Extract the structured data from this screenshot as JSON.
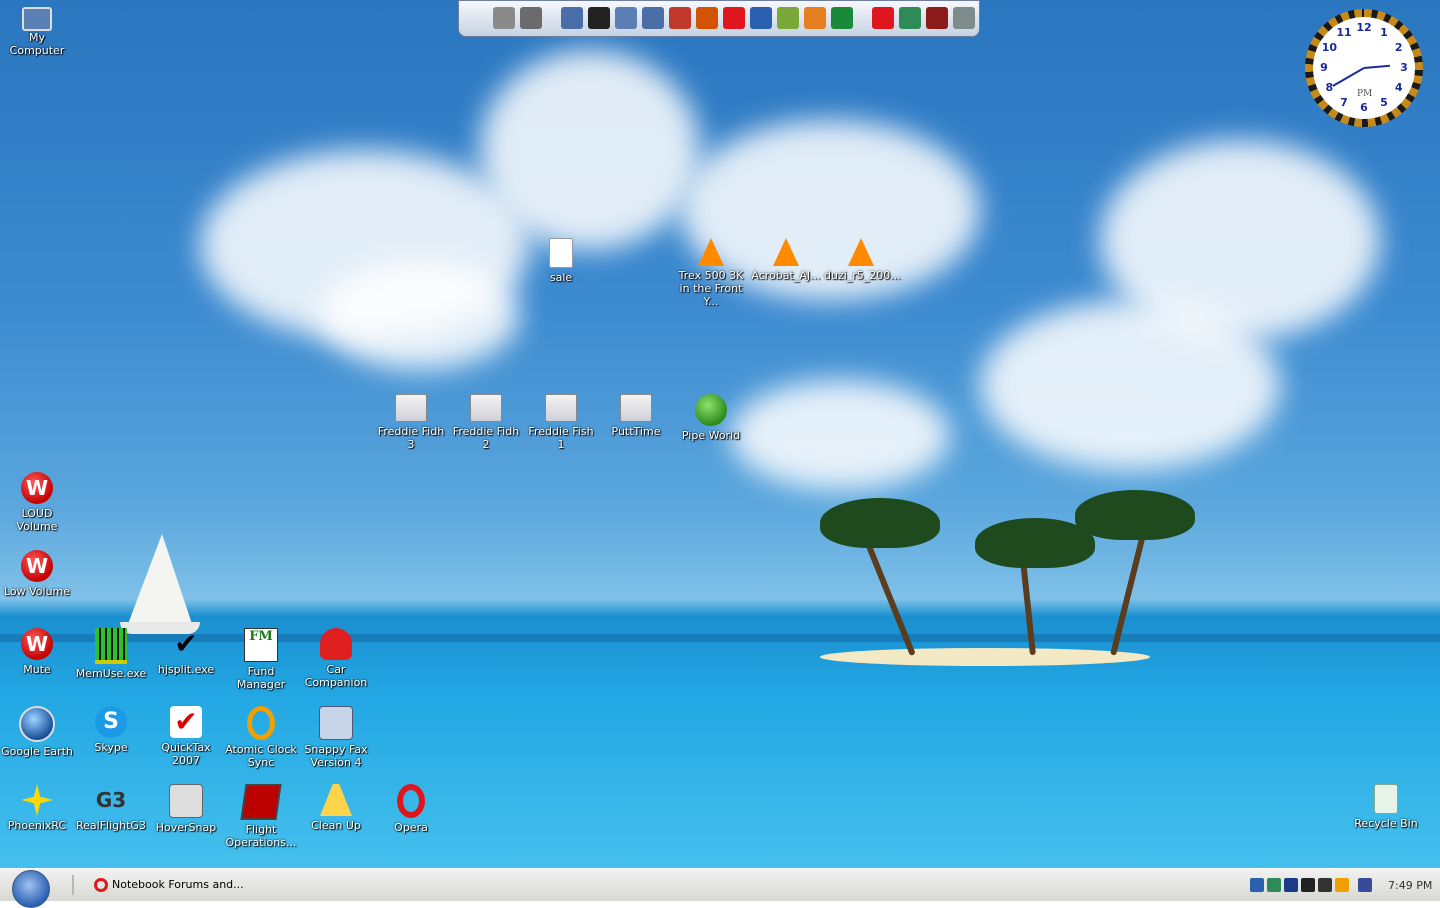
{
  "desktop": {
    "icons": [
      {
        "id": "my-computer",
        "label": "My Computer",
        "glyph": "monitor"
      },
      {
        "id": "sale",
        "label": "sale",
        "glyph": "file"
      },
      {
        "id": "trex",
        "label": "Trex 500 3K in the Front Y...",
        "glyph": "vlc"
      },
      {
        "id": "acrobat",
        "label": "Acrobat_AJ...",
        "glyph": "vlc"
      },
      {
        "id": "duzi",
        "label": "duzi_r5_200...",
        "glyph": "vlc"
      },
      {
        "id": "freddie3",
        "label": "Freddie Fidh 3",
        "glyph": "generic"
      },
      {
        "id": "freddie2",
        "label": "Freddie Fidh 2",
        "glyph": "generic"
      },
      {
        "id": "freddie1",
        "label": "Freddie Fish 1",
        "glyph": "generic"
      },
      {
        "id": "putttime",
        "label": "PuttTime",
        "glyph": "generic"
      },
      {
        "id": "pipeworld",
        "label": "Pipe World",
        "glyph": "pipe"
      },
      {
        "id": "loud-volume",
        "label": "LOUD Volume",
        "glyph": "wpaw",
        "text": "W"
      },
      {
        "id": "low-volume",
        "label": "Low Volume",
        "glyph": "wpaw",
        "text": "W"
      },
      {
        "id": "mute",
        "label": "Mute",
        "glyph": "wpaw",
        "text": "W"
      },
      {
        "id": "memuse",
        "label": "MemUse.exe",
        "glyph": "bars"
      },
      {
        "id": "hjsplit",
        "label": "hjsplit.exe",
        "glyph": "check",
        "text": "✔"
      },
      {
        "id": "fund-manager",
        "label": "Fund Manager",
        "glyph": "fm",
        "text": "FM"
      },
      {
        "id": "car-companion",
        "label": "Car Companion",
        "glyph": "car"
      },
      {
        "id": "google-earth",
        "label": "Google Earth",
        "glyph": "earth"
      },
      {
        "id": "skype",
        "label": "Skype",
        "glyph": "skype",
        "text": "S"
      },
      {
        "id": "quicktax",
        "label": "QuickTax 2007",
        "glyph": "quicktax",
        "text": "✔"
      },
      {
        "id": "atomic-clock",
        "label": "Atomic Clock Sync",
        "glyph": "atomic"
      },
      {
        "id": "snappy-fax",
        "label": "Snappy Fax Version 4",
        "glyph": "fax"
      },
      {
        "id": "phoenixrc",
        "label": "PhoenixRC",
        "glyph": "phoenix"
      },
      {
        "id": "realflight",
        "label": "RealFlightG3",
        "glyph": "g3",
        "text": "G3"
      },
      {
        "id": "hoversnap",
        "label": "HoverSnap",
        "glyph": "camera"
      },
      {
        "id": "flight-ops",
        "label": "Flight Operations...",
        "glyph": "flight"
      },
      {
        "id": "cleanup",
        "label": "Clean Up",
        "glyph": "broom"
      },
      {
        "id": "opera",
        "label": "Opera",
        "glyph": "opera"
      },
      {
        "id": "recycle-bin",
        "label": "Recycle Bin",
        "glyph": "recycle"
      }
    ]
  },
  "quickbar": {
    "icons": [
      {
        "name": "network-icon",
        "color": "#8a8a8a"
      },
      {
        "name": "tools-icon",
        "color": "#6b6b6b"
      },
      {
        "name": "monitor-icon",
        "color": "#4a6ea8"
      },
      {
        "name": "linux-penguin-icon",
        "color": "#222222"
      },
      {
        "name": "document-icon",
        "color": "#5a7fb5"
      },
      {
        "name": "screenshot-icon",
        "color": "#4a6ea8"
      },
      {
        "name": "toolbox-icon",
        "color": "#c0392b"
      },
      {
        "name": "search-icon",
        "color": "#d35400"
      },
      {
        "name": "quicktime-icon",
        "color": "#e0161e"
      },
      {
        "name": "m-logo-icon",
        "color": "#2b5fb0"
      },
      {
        "name": "pen-icon",
        "color": "#7aa83a"
      },
      {
        "name": "picasa-icon",
        "color": "#e67e22"
      },
      {
        "name": "eye-icon",
        "color": "#1a8a3a"
      },
      {
        "name": "wpaw-icon",
        "color": "#e0161e"
      },
      {
        "name": "recycle-icon",
        "color": "#2e8b57"
      },
      {
        "name": "boot-icon",
        "color": "#8b1a1a"
      },
      {
        "name": "gears-icon",
        "color": "#7f8c8d"
      }
    ]
  },
  "clock": {
    "numbers": [
      "12",
      "1",
      "2",
      "3",
      "4",
      "5",
      "6",
      "7",
      "8",
      "9",
      "10",
      "11"
    ],
    "meridiem": "PM"
  },
  "taskbar": {
    "task_label": "Notebook Forums and...",
    "time": "7:49 PM",
    "tray": [
      {
        "name": "network-tray-icon",
        "color": "#2b5fb0"
      },
      {
        "name": "shield-tray-icon",
        "color": "#2e8b57"
      },
      {
        "name": "mail-tray-icon",
        "color": "#1a3a8a"
      },
      {
        "name": "media-tray-icon",
        "color": "#222222"
      },
      {
        "name": "circle-tray-icon",
        "color": "#333333"
      },
      {
        "name": "clock-tray-icon",
        "color": "#f0a000"
      },
      {
        "name": "security-tray-icon",
        "color": "#3a4a9a"
      }
    ]
  }
}
